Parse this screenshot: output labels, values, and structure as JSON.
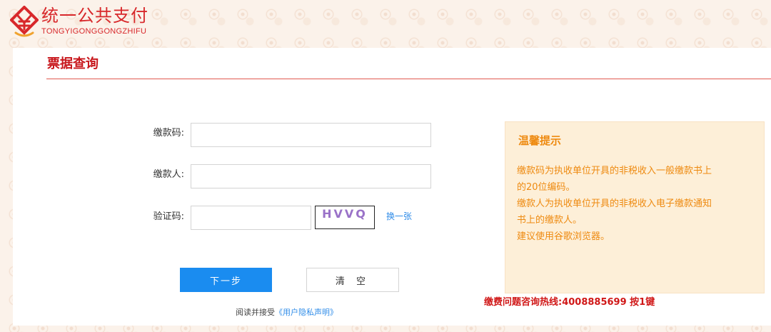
{
  "header": {
    "brand_cn": "统一公共支付",
    "brand_en": "TONGYIGONGGONGZHIFU",
    "logo_icon": "payment-logo-icon"
  },
  "page": {
    "title": "票据查询"
  },
  "form": {
    "payment_code_label": "缴款码:",
    "payment_code_value": "",
    "payer_label": "缴款人:",
    "payer_value": "",
    "captcha_label": "验证码:",
    "captcha_value": "",
    "captcha_text": "HVVQ",
    "captcha_refresh": "换一张",
    "next_button": "下一步",
    "clear_button": "清 空",
    "agree_prefix": "阅读并接受",
    "agree_link": "《用户隐私声明》"
  },
  "tips": {
    "title": "温馨提示",
    "lines": [
      "缴款码为执收单位开具的非税收入一般缴款书上",
      "的20位编码。",
      "缴款人为执收单位开具的非税收入电子缴款通知",
      "书上的缴款人。",
      "建议使用谷歌浏览器。"
    ]
  },
  "hotline": "缴费问题咨询热线:4008885699 按1键",
  "colors": {
    "brand_red": "#d8282b",
    "primary_blue": "#1a8cf0",
    "tips_orange": "#ee8a10",
    "tips_bg": "#fdefd8"
  }
}
